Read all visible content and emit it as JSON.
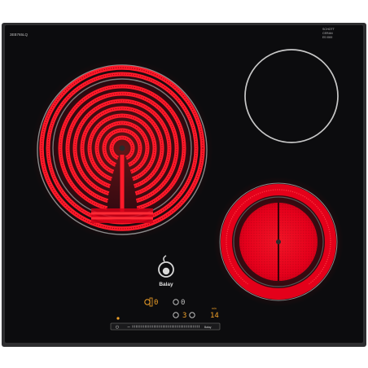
{
  "hob": {
    "model_code": "3EB765LQ",
    "brand": "Balay",
    "top_right_lines": [
      "SCHOTT",
      "CERAN",
      "ES 0000"
    ],
    "slider_label": "Balay",
    "timer_display": "14",
    "timer_unit": "min",
    "colors": {
      "glass": "#0c0c0e",
      "frame": "#2e2e30",
      "glow": "#e4001a",
      "amber": "#f0a028",
      "ring_off": "#bfbfbf"
    }
  },
  "zones": [
    {
      "name": "front-left-zone",
      "state": "on"
    },
    {
      "name": "rear-right-zone",
      "state": "off"
    },
    {
      "name": "front-right-dual-zone",
      "state": "on"
    }
  ],
  "controls": {
    "indicators": [
      {
        "name": "zone-1",
        "glyph": "0"
      },
      {
        "name": "zone-2",
        "glyph": "0"
      },
      {
        "name": "zone-3",
        "glyph": "3"
      }
    ]
  }
}
